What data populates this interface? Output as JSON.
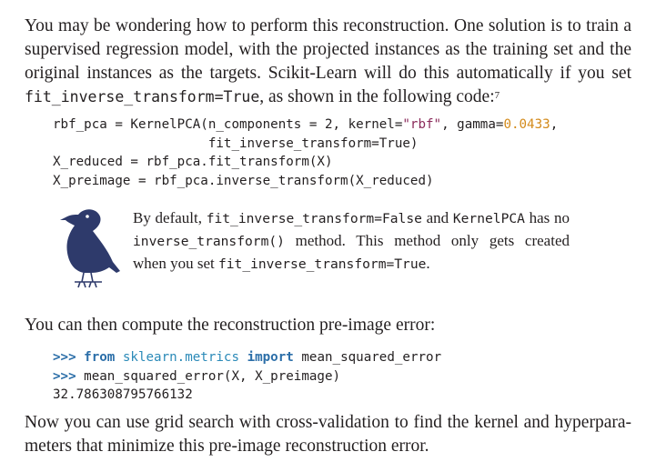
{
  "intro": {
    "line1": "You may be wondering how to perform this reconstruction. One solution is to train a",
    "line2": "supervised regression model, with the projected instances as the training set and the",
    "line3": "original instances as the targets. Scikit-Learn will do this automatically if you set",
    "line4_code": "fit_inverse_transform=True",
    "line4_text": ", as shown in the following code:",
    "footnote_mark": "7"
  },
  "code1": [
    "rbf_pca = KernelPCA(n_components = 2, kernel=\"rbf\", gamma=0.0433,",
    "                    fit_inverse_transform=True)",
    "X_reduced = rbf_pca.fit_transform(X)",
    "X_preimage = rbf_pca.inverse_transform(X_reduced)"
  ],
  "note": {
    "l1_a": "By default, ",
    "l1_code1": "fit_inverse_transform=False",
    "l1_b": " and ",
    "l1_code2": "KernelPCA",
    "l1_c": " has no",
    "l2_code": "inverse_transform()",
    "l2_text": " method. This method only gets created",
    "l3_a": "when you set ",
    "l3_code": "fit_inverse_transform=True",
    "l3_b": "."
  },
  "para2": "You can then compute the reconstruction pre-image error:",
  "code2": {
    "prompt": ">>>",
    "l1_from": "from",
    "l1_module": "sklearn.metrics",
    "l1_import": "import",
    "l1_name": "mean_squared_error",
    "l2_call": "mean_squared_error(X, X_preimage)",
    "output": "32.786308795766132"
  },
  "para3": {
    "line1": "Now you can use grid search with cross-validation to find the kernel and hyperpara-",
    "line2": "meters that minimize this pre-image reconstruction error."
  },
  "colors": {
    "text": "#231f20",
    "keyword": "#2b6ea8",
    "string": "#8a2a5a",
    "number": "#d38a1a",
    "bird": "#2e3a6b"
  },
  "icons": {
    "note_icon": "bird-icon"
  }
}
